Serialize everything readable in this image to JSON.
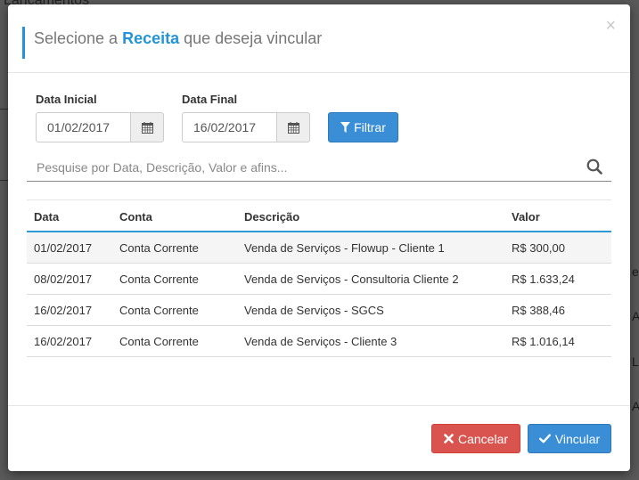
{
  "background": {
    "title": "Lançamentos",
    "edge_letters": [
      "e",
      "A",
      "L",
      "A"
    ]
  },
  "modal": {
    "title_prefix": "Selecione a ",
    "title_highlight": "Receita",
    "title_suffix": " que deseja vincular",
    "close_glyph": "×"
  },
  "filters": {
    "start_label": "Data Inicial",
    "start_value": "01/02/2017",
    "end_label": "Data Final",
    "end_value": "16/02/2017",
    "filter_button": "Filtrar"
  },
  "search": {
    "placeholder": "Pesquise por Data, Descrição, Valor e afins..."
  },
  "table": {
    "headers": [
      "Data",
      "Conta",
      "Descrição",
      "Valor"
    ],
    "rows": [
      [
        "01/02/2017",
        "Conta Corrente",
        "Venda de Serviços - Flowup - Cliente 1",
        "R$ 300,00"
      ],
      [
        "08/02/2017",
        "Conta Corrente",
        "Venda de Serviços - Consultoria Cliente 2",
        "R$ 1.633,24"
      ],
      [
        "16/02/2017",
        "Conta Corrente",
        "Venda de Serviços - SGCS",
        "R$ 388,46"
      ],
      [
        "16/02/2017",
        "Conta Corrente",
        "Venda de Serviços - Cliente 3",
        "R$ 1.016,14"
      ]
    ]
  },
  "footer": {
    "cancel_label": "Cancelar",
    "confirm_label": "Vincular"
  },
  "colors": {
    "accent": "#2494d8",
    "primary_button": "#3a8ed6",
    "danger_button": "#d9534f"
  },
  "icons": [
    "calendar-icon",
    "filter-icon",
    "search-icon",
    "times-icon",
    "check-icon",
    "close-icon"
  ]
}
